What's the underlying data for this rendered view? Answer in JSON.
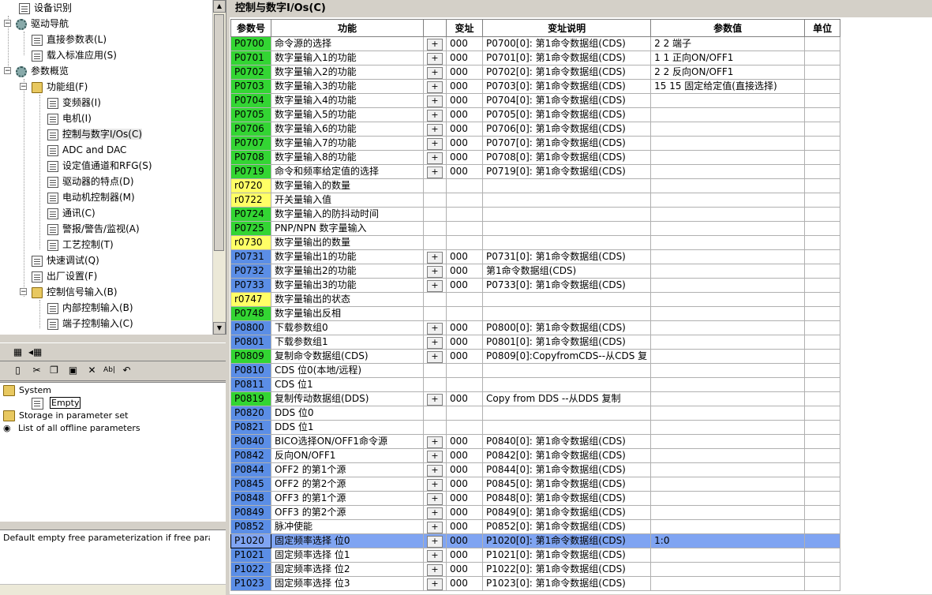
{
  "tree": {
    "items": [
      {
        "label": "设备识别"
      },
      {
        "label": "驱动导航"
      },
      {
        "label": "直接参数表(L)"
      },
      {
        "label": "载入标准应用(S)"
      },
      {
        "label": "参数概览"
      },
      {
        "label": "功能组(F)"
      },
      {
        "label": "变频器(I)"
      },
      {
        "label": "电机(I)"
      },
      {
        "label": "控制与数字I/Os(C)"
      },
      {
        "label": "ADC and DAC"
      },
      {
        "label": "设定值通道和RFG(S)"
      },
      {
        "label": "驱动器的特点(D)"
      },
      {
        "label": "电动机控制器(M)"
      },
      {
        "label": "通讯(C)"
      },
      {
        "label": "警报/警告/监视(A)"
      },
      {
        "label": "工艺控制(T)"
      },
      {
        "label": "快速调试(Q)"
      },
      {
        "label": "出厂设置(F)"
      },
      {
        "label": "控制信号输入(B)"
      },
      {
        "label": "内部控制输入(B)"
      },
      {
        "label": "端子控制输入(C)"
      }
    ]
  },
  "offline": {
    "items": [
      {
        "label": "System"
      },
      {
        "label": "Empty"
      },
      {
        "label": "Storage in parameter set"
      },
      {
        "label": "List of all offline parameters"
      }
    ]
  },
  "description": "Default empty free parameterization if free parameterization",
  "panel": {
    "title": "控制与数字I/Os(C)",
    "headers": {
      "pid": "参数号",
      "func": "功能",
      "idx": "变址",
      "idx_desc": "变址说明",
      "value": "参数值",
      "unit": "单位"
    },
    "button_label": "+",
    "rows": [
      {
        "pid": "P0700",
        "color": "green",
        "func": "命令源的选择",
        "btn": true,
        "idx": "000",
        "idx_desc": "P0700[0]: 第1命令数据组(CDS)",
        "value": "2   2 端子"
      },
      {
        "pid": "P0701",
        "color": "green",
        "func": "数字量输入1的功能",
        "btn": true,
        "idx": "000",
        "idx_desc": "P0701[0]: 第1命令数据组(CDS)",
        "value": "1   1 正向ON/OFF1"
      },
      {
        "pid": "P0702",
        "color": "green",
        "func": "数字量输入2的功能",
        "btn": true,
        "idx": "000",
        "idx_desc": "P0702[0]: 第1命令数据组(CDS)",
        "value": "2   2 反向ON/OFF1"
      },
      {
        "pid": "P0703",
        "color": "green",
        "func": "数字量输入3的功能",
        "btn": true,
        "idx": "000",
        "idx_desc": "P0703[0]: 第1命令数据组(CDS)",
        "value": "15   15 固定给定值(直接选择)"
      },
      {
        "pid": "P0704",
        "color": "green",
        "func": "数字量输入4的功能",
        "btn": true,
        "idx": "000",
        "idx_desc": "P0704[0]: 第1命令数据组(CDS)",
        "value": ""
      },
      {
        "pid": "P0705",
        "color": "green",
        "func": "数字量输入5的功能",
        "btn": true,
        "idx": "000",
        "idx_desc": "P0705[0]: 第1命令数据组(CDS)",
        "value": ""
      },
      {
        "pid": "P0706",
        "color": "green",
        "func": "数字量输入6的功能",
        "btn": true,
        "idx": "000",
        "idx_desc": "P0706[0]: 第1命令数据组(CDS)",
        "value": ""
      },
      {
        "pid": "P0707",
        "color": "green",
        "func": "数字量输入7的功能",
        "btn": true,
        "idx": "000",
        "idx_desc": "P0707[0]: 第1命令数据组(CDS)",
        "value": ""
      },
      {
        "pid": "P0708",
        "color": "green",
        "func": "数字量输入8的功能",
        "btn": true,
        "idx": "000",
        "idx_desc": "P0708[0]: 第1命令数据组(CDS)",
        "value": ""
      },
      {
        "pid": "P0719",
        "color": "green",
        "func": "命令和频率给定值的选择",
        "btn": true,
        "idx": "000",
        "idx_desc": "P0719[0]: 第1命令数据组(CDS)",
        "value": ""
      },
      {
        "pid": "r0720",
        "color": "yellow",
        "func": "数字量输入的数量",
        "btn": false,
        "idx": "",
        "idx_desc": "",
        "value": ""
      },
      {
        "pid": "r0722",
        "color": "yellow",
        "func": "开关量输入值",
        "btn": false,
        "idx": "",
        "idx_desc": "",
        "value": ""
      },
      {
        "pid": "P0724",
        "color": "green",
        "func": "数字量输入的防抖动时间",
        "btn": false,
        "idx": "",
        "idx_desc": "",
        "value": ""
      },
      {
        "pid": "P0725",
        "color": "green",
        "func": "PNP/NPN 数字量输入",
        "btn": false,
        "idx": "",
        "idx_desc": "",
        "value": ""
      },
      {
        "pid": "r0730",
        "color": "yellow",
        "func": "数字量输出的数量",
        "btn": false,
        "idx": "",
        "idx_desc": "",
        "value": ""
      },
      {
        "pid": "P0731",
        "color": "blue",
        "func": "数字量输出1的功能",
        "btn": true,
        "idx": "000",
        "idx_desc": "P0731[0]: 第1命令数据组(CDS)",
        "value": ""
      },
      {
        "pid": "P0732",
        "color": "blue",
        "func": "数字量输出2的功能",
        "btn": true,
        "idx": "000",
        "idx_desc": "第1命令数据组(CDS)",
        "value": ""
      },
      {
        "pid": "P0733",
        "color": "blue",
        "func": "数字量输出3的功能",
        "btn": true,
        "idx": "000",
        "idx_desc": "P0733[0]: 第1命令数据组(CDS)",
        "value": ""
      },
      {
        "pid": "r0747",
        "color": "yellow",
        "func": "数字量输出的状态",
        "btn": false,
        "idx": "",
        "idx_desc": "",
        "value": ""
      },
      {
        "pid": "P0748",
        "color": "green",
        "func": "数字量输出反相",
        "btn": false,
        "idx": "",
        "idx_desc": "",
        "value": ""
      },
      {
        "pid": "P0800",
        "color": "blue",
        "func": "下载参数组0",
        "btn": true,
        "idx": "000",
        "idx_desc": "P0800[0]: 第1命令数据组(CDS)",
        "value": ""
      },
      {
        "pid": "P0801",
        "color": "blue",
        "func": "下载参数组1",
        "btn": true,
        "idx": "000",
        "idx_desc": "P0801[0]: 第1命令数据组(CDS)",
        "value": ""
      },
      {
        "pid": "P0809",
        "color": "green",
        "func": "复制命令数据组(CDS)",
        "btn": true,
        "idx": "000",
        "idx_desc": "P0809[0]:CopyfromCDS--从CDS 复",
        "value": ""
      },
      {
        "pid": "P0810",
        "color": "blue",
        "func": "CDS 位0(本地/远程)",
        "btn": false,
        "idx": "",
        "idx_desc": "",
        "value": ""
      },
      {
        "pid": "P0811",
        "color": "blue",
        "func": "CDS 位1",
        "btn": false,
        "idx": "",
        "idx_desc": "",
        "value": ""
      },
      {
        "pid": "P0819",
        "color": "green",
        "func": "复制传动数据组(DDS)",
        "btn": true,
        "idx": "000",
        "idx_desc": " Copy from DDS --从DDS 复制",
        "value": ""
      },
      {
        "pid": "P0820",
        "color": "blue",
        "func": "DDS 位0",
        "btn": false,
        "idx": "",
        "idx_desc": "",
        "value": ""
      },
      {
        "pid": "P0821",
        "color": "blue",
        "func": "DDS 位1",
        "btn": false,
        "idx": "",
        "idx_desc": "",
        "value": ""
      },
      {
        "pid": "P0840",
        "color": "blue",
        "func": "BICO选择ON/OFF1命令源",
        "btn": true,
        "idx": "000",
        "idx_desc": "P0840[0]: 第1命令数据组(CDS)",
        "value": ""
      },
      {
        "pid": "P0842",
        "color": "blue",
        "func": "反向ON/OFF1",
        "btn": true,
        "idx": "000",
        "idx_desc": "P0842[0]: 第1命令数据组(CDS)",
        "value": ""
      },
      {
        "pid": "P0844",
        "color": "blue",
        "func": "OFF2 的第1个源",
        "btn": true,
        "idx": "000",
        "idx_desc": "P0844[0]: 第1命令数据组(CDS)",
        "value": ""
      },
      {
        "pid": "P0845",
        "color": "blue",
        "func": "OFF2 的第2个源",
        "btn": true,
        "idx": "000",
        "idx_desc": "P0845[0]: 第1命令数据组(CDS)",
        "value": ""
      },
      {
        "pid": "P0848",
        "color": "blue",
        "func": "OFF3 的第1个源",
        "btn": true,
        "idx": "000",
        "idx_desc": "P0848[0]: 第1命令数据组(CDS)",
        "value": ""
      },
      {
        "pid": "P0849",
        "color": "blue",
        "func": "OFF3 的第2个源",
        "btn": true,
        "idx": "000",
        "idx_desc": "P0849[0]: 第1命令数据组(CDS)",
        "value": ""
      },
      {
        "pid": "P0852",
        "color": "blue",
        "func": "脉冲使能",
        "btn": true,
        "idx": "000",
        "idx_desc": "P0852[0]: 第1命令数据组(CDS)",
        "value": ""
      },
      {
        "pid": "P1020",
        "color": "blue",
        "func": "固定频率选择 位0",
        "btn": true,
        "idx": "000",
        "idx_desc": "P1020[0]: 第1命令数据组(CDS)",
        "value": "1:0",
        "selected": true
      },
      {
        "pid": "P1021",
        "color": "blue",
        "func": "固定频率选择 位1",
        "btn": true,
        "idx": "000",
        "idx_desc": "P1021[0]: 第1命令数据组(CDS)",
        "value": ""
      },
      {
        "pid": "P1022",
        "color": "blue",
        "func": "固定频率选择 位2",
        "btn": true,
        "idx": "000",
        "idx_desc": "P1022[0]: 第1命令数据组(CDS)",
        "value": ""
      },
      {
        "pid": "P1023",
        "color": "blue",
        "func": "固定频率选择 位3",
        "btn": true,
        "idx": "000",
        "idx_desc": "P1023[0]: 第1命令数据组(CDS)",
        "value": ""
      }
    ]
  }
}
